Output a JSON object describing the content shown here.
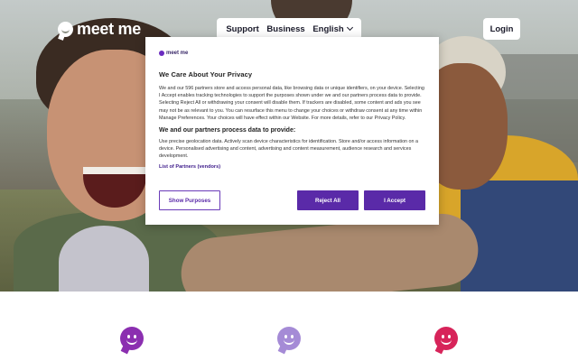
{
  "brand": {
    "logo_text": "meet me"
  },
  "nav": {
    "items": [
      {
        "label": "Support"
      },
      {
        "label": "Business"
      },
      {
        "label": "English"
      }
    ],
    "login_label": "Login"
  },
  "consent": {
    "logo_text": "meet me",
    "title": "We Care About Your Privacy",
    "body": "We and our 596 partners store and access personal data, like browsing data or unique identifiers, on your device. Selecting I Accept enables tracking technologies to support the purposes shown under we and our partners process data to provide. Selecting Reject All or withdrawing your consent will disable them. If trackers are disabled, some content and ads you see may not be as relevant to you. You can resurface this menu to change your choices or withdraw consent at any time within Manage Preferences. Your choices will have effect within our Website. For more details, refer to our Privacy Policy.",
    "subtitle": "We and our partners process data to provide:",
    "purposes": "Use precise geolocation data. Actively scan device characteristics for identification. Store and/or access information on a device. Personalised advertising and content, advertising and content measurement, audience research and services development.",
    "partners_link": "List of Partners (vendors)",
    "show_purposes": "Show Purposes",
    "reject_all": "Reject All",
    "accept": "I Accept"
  },
  "features": {
    "icons": [
      {
        "icon": "smile-chat-icon",
        "color": "#8b2fb0"
      },
      {
        "icon": "smile-chat-icon",
        "color": "#a58bd6"
      },
      {
        "icon": "smile-chat-icon",
        "color": "#d7245a"
      }
    ]
  }
}
